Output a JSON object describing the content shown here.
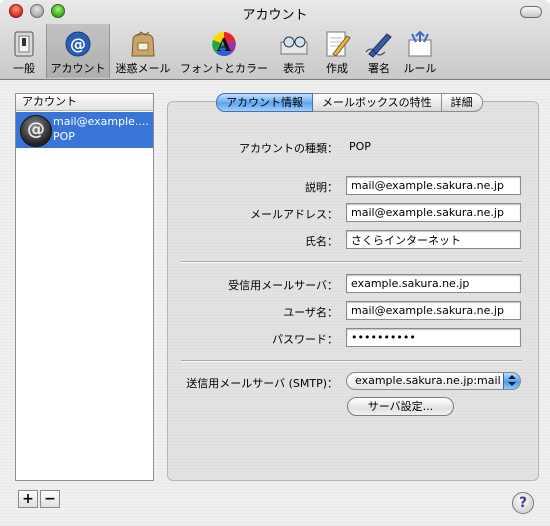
{
  "window": {
    "title": "アカウント"
  },
  "toolbar": {
    "items": [
      {
        "label": "一般",
        "icon": "switch-icon"
      },
      {
        "label": "アカウント",
        "icon": "at-sign-icon",
        "selected": true
      },
      {
        "label": "迷惑メール",
        "icon": "junk-mail-bag-icon"
      },
      {
        "label": "フォントとカラー",
        "icon": "font-color-icon"
      },
      {
        "label": "表示",
        "icon": "viewing-glasses-icon"
      },
      {
        "label": "作成",
        "icon": "compose-pencil-icon"
      },
      {
        "label": "署名",
        "icon": "signature-pen-icon"
      },
      {
        "label": "ルール",
        "icon": "rules-arrows-icon"
      }
    ]
  },
  "accounts": {
    "header": "アカウント",
    "items": [
      {
        "name": "mail@example....",
        "type": "POP",
        "icon": "at-sign-icon"
      }
    ],
    "add_label": "+",
    "remove_label": "−"
  },
  "tabs": [
    {
      "label": "アカウント情報",
      "active": true
    },
    {
      "label": "メールボックスの特性"
    },
    {
      "label": "詳細"
    }
  ],
  "form": {
    "account_type_label": "アカウントの種類：",
    "account_type_value": "POP",
    "description_label": "説明：",
    "description_value": "mail@example.sakura.ne.jp",
    "email_label": "メールアドレス：",
    "email_value": "mail@example.sakura.ne.jp",
    "fullname_label": "氏名：",
    "fullname_value": "さくらインターネット",
    "incoming_label": "受信用メールサーバ：",
    "incoming_value": "example.sakura.ne.jp",
    "username_label": "ユーザ名：",
    "username_value": "mail@example.sakura.ne.jp",
    "password_label": "パスワード：",
    "password_value": "••••••••••",
    "smtp_label": "送信用メールサーバ (SMTP)：",
    "smtp_value": "example.sakura.ne.jp:mail",
    "server_settings_label": "サーバ設定..."
  },
  "help": {
    "label": "?"
  },
  "colors": {
    "selection": "#3875d7",
    "tab_active": "#6aaef0"
  }
}
